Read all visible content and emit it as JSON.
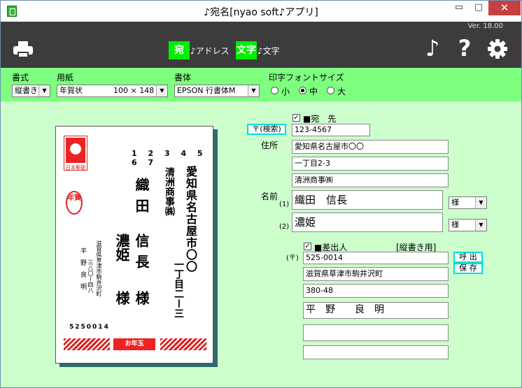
{
  "window": {
    "title": "♪宛名[nyao soft♪アプリ]",
    "min_glyph": "▭",
    "max_glyph": "▢",
    "close_glyph": "✕"
  },
  "toolbar": {
    "version": "Ver. 18.00",
    "address_icon_text": "宛",
    "address_label": "♪アドレス",
    "text_icon_text": "文字",
    "text_label": "♪文字",
    "music_glyph": "♪",
    "help_glyph": "?"
  },
  "options": {
    "format_label": "書式",
    "format_value": "縦書き",
    "paper_label": "用紙",
    "paper_value": "年賀状　　　　100 × 148",
    "font_label": "書体",
    "font_value": "EPSON 行書体M",
    "size_label": "印字フォントサイズ",
    "size_options": [
      "小",
      "中",
      "大"
    ],
    "size_selected": "中",
    "arrow_glyph": "▼"
  },
  "preview": {
    "stamp_text": "日本郵便",
    "recipient_zip": "1 2 3 4 5 6 7",
    "nenga_text": "年賀",
    "addr1": "愛知県名古屋市〇〇",
    "addr2": "一丁目二ー三",
    "company": "清洲商事㈱",
    "name1": "織田",
    "name2": "信長",
    "name3": "濃姫",
    "honor1": "様",
    "honor2": "様",
    "sender_addr1": "滋賀県草津市駒井沢町",
    "sender_addr2": "三八〇ー四八",
    "sender_name": "平野良明",
    "sender_zip": "5250014",
    "badge_text": "お年玉"
  },
  "recipient": {
    "check_label": "■宛　先",
    "zip_search_button": "〒(検索)",
    "zip": "123-4567",
    "address_label": "住所",
    "address1": "愛知県名古屋市〇〇",
    "address2": "一丁目2-3",
    "address3": "清洲商事㈱",
    "name_label": "名前",
    "name_index1": "(1)",
    "name1": "織田　信長",
    "honorific1": "様",
    "name_index2": "(2)",
    "name2": "濃姫",
    "honorific2": "様"
  },
  "sender": {
    "check_label": "■差出人",
    "mode_label": "[縦書き用]",
    "zip_label": "(〒)",
    "zip": "525-0014",
    "recall_button": "呼 出",
    "save_button": "保 存",
    "address1": "滋賀県草津市駒井沢町",
    "address2": "380-48",
    "name": "平　野　　良　明",
    "extra1": "",
    "extra2": ""
  }
}
